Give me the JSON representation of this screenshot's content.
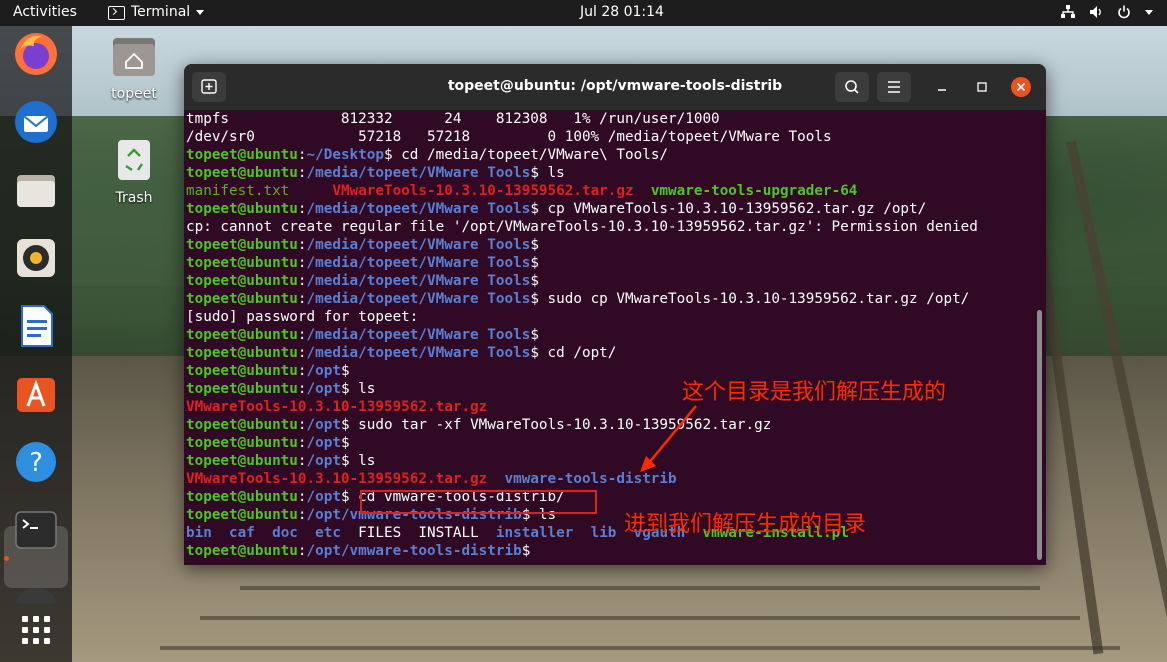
{
  "topbar": {
    "activities": "Activities",
    "app_name": "Terminal",
    "clock": "Jul 28  01:14"
  },
  "desktop": {
    "home_label": "topeet",
    "trash_label": "Trash"
  },
  "dock": {
    "items": [
      "firefox-icon",
      "thunderbird-icon",
      "files-icon",
      "rhythmbox-icon",
      "libreoffice-writer-icon",
      "software-center-icon",
      "help-icon",
      "terminal-icon",
      "show-apps-icon"
    ]
  },
  "terminal": {
    "title": "topeet@ubuntu: /opt/vmware-tools-distrib",
    "lines": [
      [
        {
          "t": "tmpfs             812332      24    812308   1% /run/user/1000",
          "c": ""
        }
      ],
      [
        {
          "t": "/dev/sr0            57218   57218         0 100% /media/topeet/VMware Tools",
          "c": ""
        }
      ],
      [
        {
          "t": "topeet@ubuntu",
          "c": "g"
        },
        {
          "t": ":",
          "c": ""
        },
        {
          "t": "~/Desktop",
          "c": "b"
        },
        {
          "t": "$ cd /media/topeet/VMware\\ Tools/",
          "c": ""
        }
      ],
      [
        {
          "t": "topeet@ubuntu",
          "c": "g"
        },
        {
          "t": ":",
          "c": ""
        },
        {
          "t": "/media/topeet/VMware Tools",
          "c": "b"
        },
        {
          "t": "$ ls",
          "c": ""
        }
      ],
      [
        {
          "t": "manifest.txt",
          "c": "gr"
        },
        {
          "t": "     ",
          "c": ""
        },
        {
          "t": "VMwareTools-10.3.10-13959562.tar.gz",
          "c": "r"
        },
        {
          "t": "  ",
          "c": ""
        },
        {
          "t": "vmware-tools-upgrader-64",
          "c": "g"
        }
      ],
      [
        {
          "t": "topeet@ubuntu",
          "c": "g"
        },
        {
          "t": ":",
          "c": ""
        },
        {
          "t": "/media/topeet/VMware Tools",
          "c": "b"
        },
        {
          "t": "$ cp VMwareTools-10.3.10-13959562.tar.gz /opt/",
          "c": ""
        }
      ],
      [
        {
          "t": "cp: cannot create regular file '/opt/VMwareTools-10.3.10-13959562.tar.gz': Permission denied",
          "c": ""
        }
      ],
      [
        {
          "t": "topeet@ubuntu",
          "c": "g"
        },
        {
          "t": ":",
          "c": ""
        },
        {
          "t": "/media/topeet/VMware Tools",
          "c": "b"
        },
        {
          "t": "$",
          "c": ""
        }
      ],
      [
        {
          "t": "topeet@ubuntu",
          "c": "g"
        },
        {
          "t": ":",
          "c": ""
        },
        {
          "t": "/media/topeet/VMware Tools",
          "c": "b"
        },
        {
          "t": "$",
          "c": ""
        }
      ],
      [
        {
          "t": "topeet@ubuntu",
          "c": "g"
        },
        {
          "t": ":",
          "c": ""
        },
        {
          "t": "/media/topeet/VMware Tools",
          "c": "b"
        },
        {
          "t": "$",
          "c": ""
        }
      ],
      [
        {
          "t": "topeet@ubuntu",
          "c": "g"
        },
        {
          "t": ":",
          "c": ""
        },
        {
          "t": "/media/topeet/VMware Tools",
          "c": "b"
        },
        {
          "t": "$ sudo cp VMwareTools-10.3.10-13959562.tar.gz /opt/",
          "c": ""
        }
      ],
      [
        {
          "t": "[sudo] password for topeet:",
          "c": ""
        }
      ],
      [
        {
          "t": "topeet@ubuntu",
          "c": "g"
        },
        {
          "t": ":",
          "c": ""
        },
        {
          "t": "/media/topeet/VMware Tools",
          "c": "b"
        },
        {
          "t": "$",
          "c": ""
        }
      ],
      [
        {
          "t": "topeet@ubuntu",
          "c": "g"
        },
        {
          "t": ":",
          "c": ""
        },
        {
          "t": "/media/topeet/VMware Tools",
          "c": "b"
        },
        {
          "t": "$ cd /opt/",
          "c": ""
        }
      ],
      [
        {
          "t": "topeet@ubuntu",
          "c": "g"
        },
        {
          "t": ":",
          "c": ""
        },
        {
          "t": "/opt",
          "c": "b"
        },
        {
          "t": "$",
          "c": ""
        }
      ],
      [
        {
          "t": "topeet@ubuntu",
          "c": "g"
        },
        {
          "t": ":",
          "c": ""
        },
        {
          "t": "/opt",
          "c": "b"
        },
        {
          "t": "$ ls",
          "c": ""
        }
      ],
      [
        {
          "t": "VMwareTools-10.3.10-13959562.tar.gz",
          "c": "r"
        }
      ],
      [
        {
          "t": "topeet@ubuntu",
          "c": "g"
        },
        {
          "t": ":",
          "c": ""
        },
        {
          "t": "/opt",
          "c": "b"
        },
        {
          "t": "$ sudo tar -xf VMwareTools-10.3.10-13959562.tar.gz",
          "c": ""
        }
      ],
      [
        {
          "t": "topeet@ubuntu",
          "c": "g"
        },
        {
          "t": ":",
          "c": ""
        },
        {
          "t": "/opt",
          "c": "b"
        },
        {
          "t": "$",
          "c": ""
        }
      ],
      [
        {
          "t": "topeet@ubuntu",
          "c": "g"
        },
        {
          "t": ":",
          "c": ""
        },
        {
          "t": "/opt",
          "c": "b"
        },
        {
          "t": "$ ls",
          "c": ""
        }
      ],
      [
        {
          "t": "VMwareTools-10.3.10-13959562.tar.gz",
          "c": "r"
        },
        {
          "t": "  ",
          "c": ""
        },
        {
          "t": "vmware-tools-distrib",
          "c": "bl"
        }
      ],
      [
        {
          "t": "topeet@ubuntu",
          "c": "g"
        },
        {
          "t": ":",
          "c": ""
        },
        {
          "t": "/opt",
          "c": "b"
        },
        {
          "t": "$ cd vmware-tools-distrib/",
          "c": ""
        }
      ],
      [
        {
          "t": "topeet@ubuntu",
          "c": "g"
        },
        {
          "t": ":",
          "c": ""
        },
        {
          "t": "/opt/vmware-tools-distrib",
          "c": "b"
        },
        {
          "t": "$ ls",
          "c": ""
        }
      ],
      [
        {
          "t": "bin",
          "c": "bl"
        },
        {
          "t": "  ",
          "c": ""
        },
        {
          "t": "caf",
          "c": "bl"
        },
        {
          "t": "  ",
          "c": ""
        },
        {
          "t": "doc",
          "c": "bl"
        },
        {
          "t": "  ",
          "c": ""
        },
        {
          "t": "etc",
          "c": "bl"
        },
        {
          "t": "  FILES  INSTALL  ",
          "c": ""
        },
        {
          "t": "installer",
          "c": "bl"
        },
        {
          "t": "  ",
          "c": ""
        },
        {
          "t": "lib",
          "c": "bl"
        },
        {
          "t": "  ",
          "c": ""
        },
        {
          "t": "vgauth",
          "c": "bl"
        },
        {
          "t": "  ",
          "c": ""
        },
        {
          "t": "vmware-install.pl",
          "c": "g"
        }
      ],
      [
        {
          "t": "topeet@ubuntu",
          "c": "g"
        },
        {
          "t": ":",
          "c": ""
        },
        {
          "t": "/opt/vmware-tools-distrib",
          "c": "b"
        },
        {
          "t": "$ ",
          "c": ""
        }
      ]
    ]
  },
  "annotations": {
    "top": "这个目录是我们解压生成的",
    "bottom": "进到我们解压生成的目录",
    "color": "#ff2a00"
  }
}
